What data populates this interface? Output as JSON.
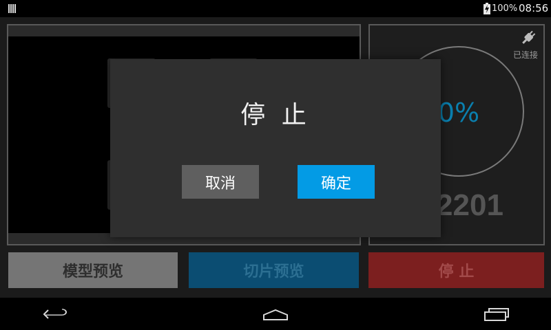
{
  "status_bar": {
    "battery": "100%",
    "time": "08:56"
  },
  "status_panel": {
    "connection": "已连接",
    "progress": "0%",
    "layer_count": "2201"
  },
  "buttons": {
    "model_preview": "模型预览",
    "slice_preview": "切片预览",
    "stop": "停 止"
  },
  "dialog": {
    "title": "停 止",
    "cancel": "取消",
    "confirm": "确定"
  },
  "colors": {
    "accent": "#039be5",
    "stop": "#7c1f1f",
    "slice": "#0b4d72"
  }
}
